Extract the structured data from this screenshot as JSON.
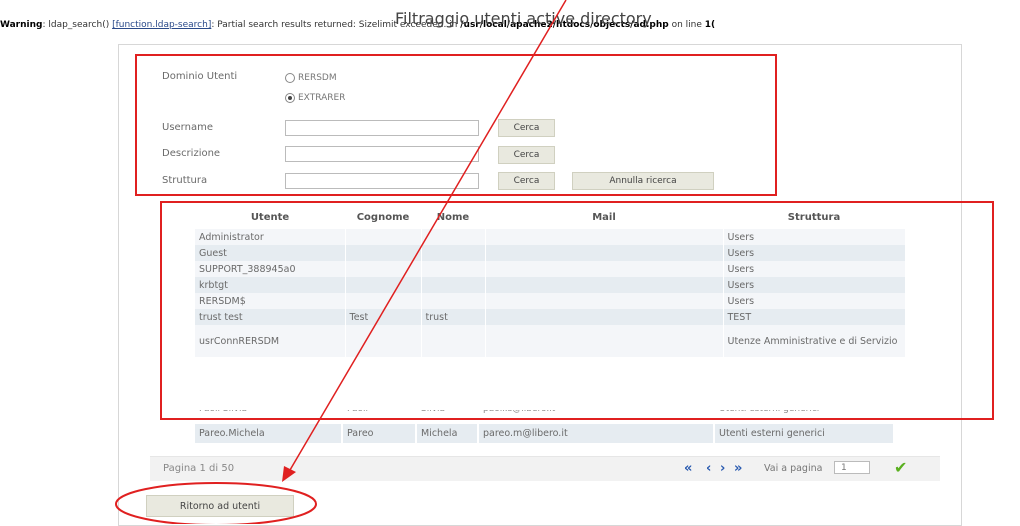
{
  "warning": {
    "prefix": "Warning",
    "text1": ": ldap_search() ",
    "fn": "[function.ldap-search]",
    "text2": ": Partial search results returned: Sizelimit exceeded. in ",
    "path": "/usr/local/apache2/htdocs/objects/ad.php",
    "text3": " on line ",
    "line": "1("
  },
  "title": "Filtraggio utenti active directory",
  "form": {
    "domain_label": "Dominio Utenti",
    "radio1": "RERSDM",
    "radio2": "EXTRARER",
    "username_label": "Username",
    "description_label": "Descrizione",
    "structure_label": "Struttura",
    "search_label": "Cerca",
    "cancel_label": "Annulla ricerca"
  },
  "table": {
    "headers": [
      "Utente",
      "Cognome",
      "Nome",
      "Mail",
      "Struttura"
    ],
    "rows": [
      [
        "Administrator",
        "",
        "",
        "",
        "Users"
      ],
      [
        "Guest",
        "",
        "",
        "",
        "Users"
      ],
      [
        "SUPPORT_388945a0",
        "",
        "",
        "",
        "Users"
      ],
      [
        "krbtgt",
        "",
        "",
        "",
        "Users"
      ],
      [
        "RERSDM$",
        "",
        "",
        "",
        "Users"
      ],
      [
        "trust test",
        "Test",
        "trust",
        "",
        "TEST"
      ],
      [
        "usrConnRERSDM",
        "",
        "",
        "",
        "Utenze Amministrative e di Servizio"
      ]
    ],
    "cut_row": [
      "Paoli Silvia",
      "Paoli",
      "Silvia",
      "paoli.s@libero.it",
      "Utenti esterni generici"
    ],
    "last_row": [
      "Pareo.Michela",
      "Pareo",
      "Michela",
      "pareo.m@libero.it",
      "Utenti esterni generici"
    ]
  },
  "pager": {
    "page_text": "Pagina 1 di 50",
    "goto_label": "Vai a pagina",
    "goto_value": "1",
    "first": "«",
    "prev": "‹",
    "next": "›",
    "last": "»"
  },
  "back_label": "Ritorno ad utenti",
  "colors": {
    "annotation": "#e02020",
    "link": "#2a5bb0",
    "ok": "#5ab020"
  }
}
